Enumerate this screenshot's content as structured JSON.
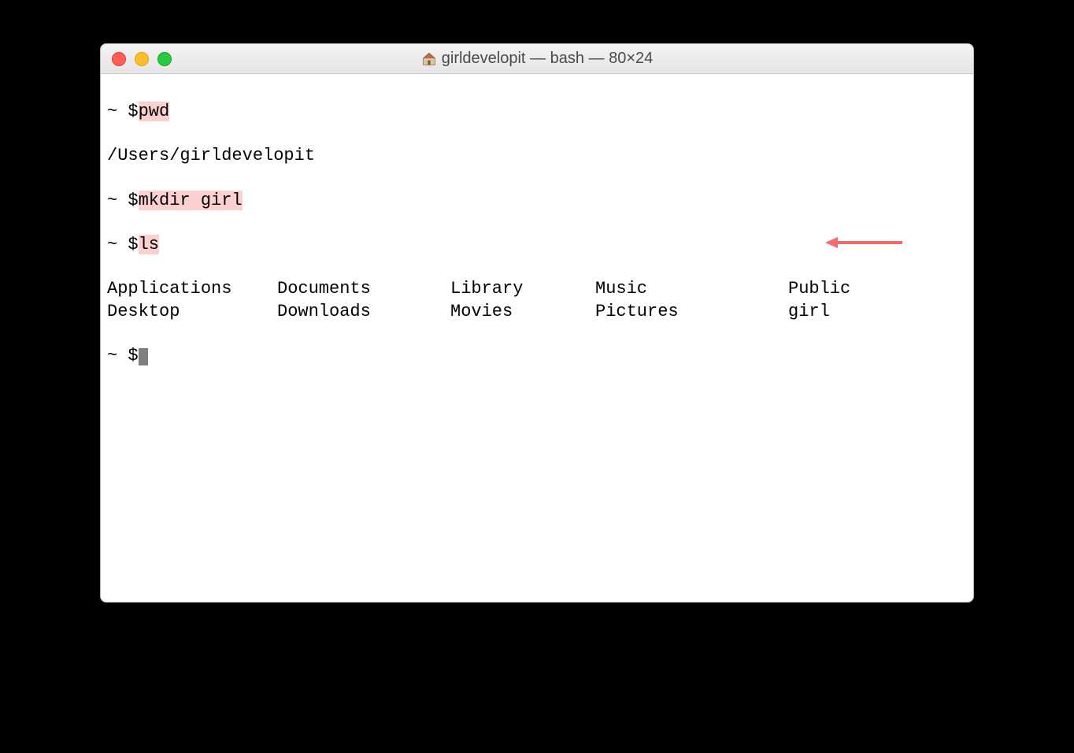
{
  "window": {
    "title": "girldevelopit — bash — 80×24"
  },
  "terminal": {
    "prompt": "~ $",
    "lines": {
      "cmd_pwd": "pwd",
      "pwd_output": "/Users/girldevelopit",
      "cmd_mkdir": "mkdir girl",
      "cmd_ls": "ls"
    },
    "ls_output": {
      "col1": [
        "Applications",
        "Desktop"
      ],
      "col2": [
        "Documents",
        "Downloads"
      ],
      "col3": [
        "Library",
        "Movies"
      ],
      "col4": [
        "Music",
        "Pictures"
      ],
      "col5": [
        "Public",
        "girl"
      ]
    }
  }
}
